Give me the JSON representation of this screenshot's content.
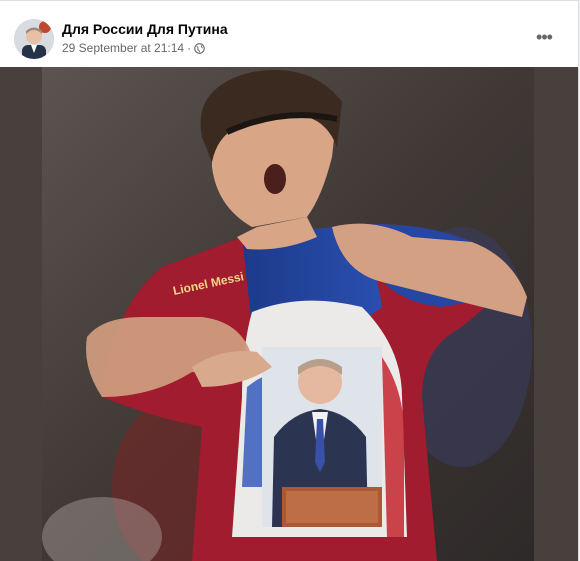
{
  "post": {
    "author": "Для России Для Путина",
    "timestamp": "29 September at 21:14",
    "separator": "·",
    "audience_icon": "globe-icon",
    "more_icon": "more-options-icon",
    "more_label": "•••",
    "avatar_icon": "profile-avatar",
    "jersey_name": "Lionel Messi"
  },
  "colors": {
    "accent": "#1877f2",
    "meta_text": "#65676b",
    "media_background": "#48403c"
  }
}
